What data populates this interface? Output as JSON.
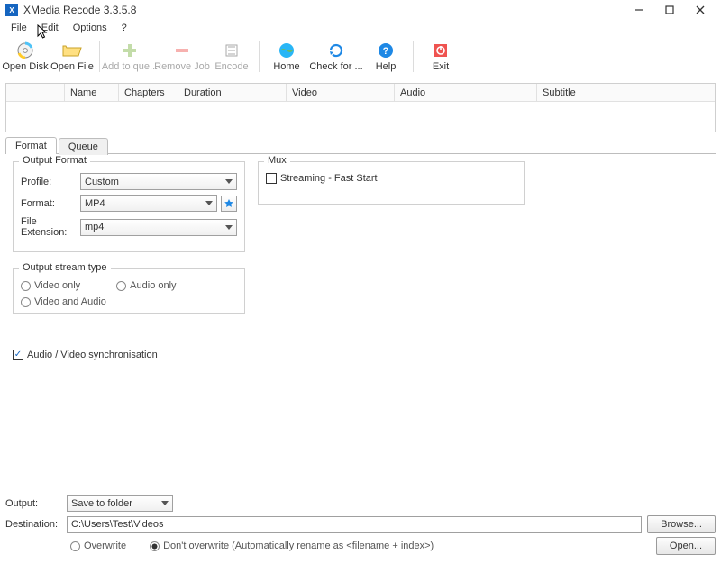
{
  "window": {
    "app_icon_letter": "X",
    "title": "XMedia Recode 3.3.5.8"
  },
  "menubar": {
    "file": "File",
    "edit": "Edit",
    "options": "Options",
    "help": "?"
  },
  "toolbar": {
    "open_disk": "Open Disk",
    "open_file": "Open File",
    "add_queue": "Add to que...",
    "remove_job": "Remove Job",
    "encode": "Encode",
    "home": "Home",
    "check_update": "Check for ...",
    "help": "Help",
    "exit": "Exit"
  },
  "table": {
    "name": "Name",
    "chapters": "Chapters",
    "duration": "Duration",
    "video": "Video",
    "audio": "Audio",
    "subtitle": "Subtitle"
  },
  "tabs": {
    "format": "Format",
    "queue": "Queue"
  },
  "output_format": {
    "legend": "Output Format",
    "profile_label": "Profile:",
    "profile_value": "Custom",
    "format_label": "Format:",
    "format_value": "MP4",
    "ext_label": "File Extension:",
    "ext_value": "mp4"
  },
  "mux": {
    "legend": "Mux",
    "fast_start": "Streaming - Fast Start"
  },
  "stream": {
    "legend": "Output stream type",
    "video_only": "Video only",
    "audio_only": "Audio only",
    "both": "Video and Audio"
  },
  "av_sync": "Audio / Video synchronisation",
  "bottom": {
    "output_label": "Output:",
    "output_value": "Save to folder",
    "dest_label": "Destination:",
    "dest_value": "C:\\Users\\Test\\Videos",
    "browse": "Browse...",
    "open": "Open...",
    "overwrite": "Overwrite",
    "dont_overwrite": "Don't overwrite (Automatically rename as <filename + index>)"
  }
}
